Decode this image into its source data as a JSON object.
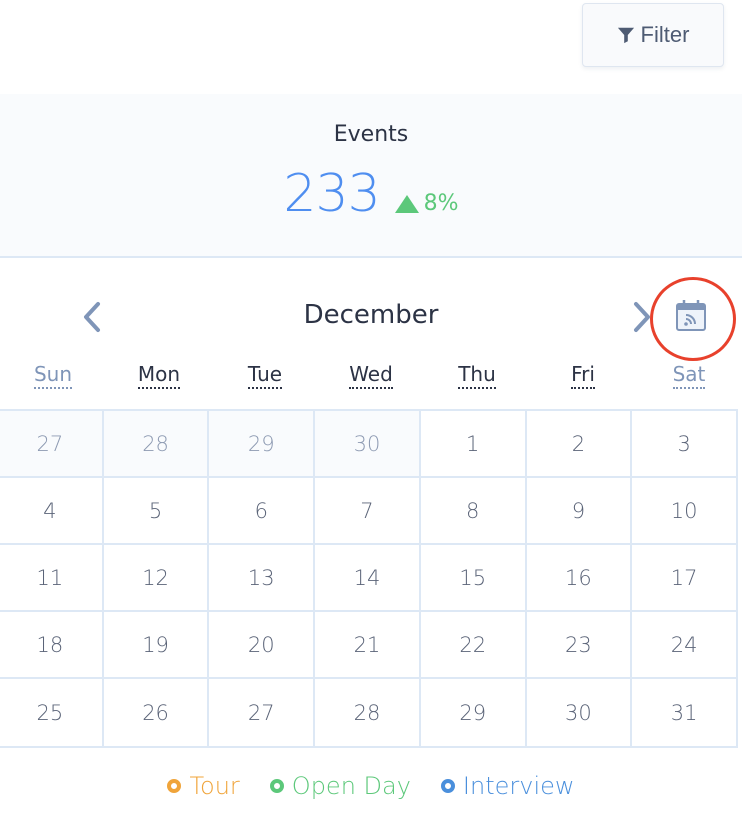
{
  "toolbar": {
    "filter_label": "Filter",
    "filter_icon": "funnel-icon"
  },
  "stats": {
    "title": "Events",
    "value": "233",
    "delta": "8%",
    "delta_direction": "up",
    "value_color": "#4f8ef0",
    "delta_color": "#5cc87a"
  },
  "calendar": {
    "month": "December",
    "prev_icon": "chevron-left-icon",
    "next_icon": "chevron-right-icon",
    "feed_icon": "calendar-feed-icon",
    "weekdays": [
      "Sun",
      "Mon",
      "Tue",
      "Wed",
      "Thu",
      "Fri",
      "Sat"
    ],
    "weeks": [
      [
        {
          "d": "27",
          "o": true
        },
        {
          "d": "28",
          "o": true
        },
        {
          "d": "29",
          "o": true
        },
        {
          "d": "30",
          "o": true
        },
        {
          "d": "1"
        },
        {
          "d": "2"
        },
        {
          "d": "3"
        }
      ],
      [
        {
          "d": "4"
        },
        {
          "d": "5"
        },
        {
          "d": "6"
        },
        {
          "d": "7"
        },
        {
          "d": "8"
        },
        {
          "d": "9"
        },
        {
          "d": "10"
        }
      ],
      [
        {
          "d": "11"
        },
        {
          "d": "12"
        },
        {
          "d": "13"
        },
        {
          "d": "14"
        },
        {
          "d": "15"
        },
        {
          "d": "16"
        },
        {
          "d": "17"
        }
      ],
      [
        {
          "d": "18"
        },
        {
          "d": "19"
        },
        {
          "d": "20"
        },
        {
          "d": "21"
        },
        {
          "d": "22"
        },
        {
          "d": "23"
        },
        {
          "d": "24"
        }
      ],
      [
        {
          "d": "25"
        },
        {
          "d": "26"
        },
        {
          "d": "27"
        },
        {
          "d": "28"
        },
        {
          "d": "29"
        },
        {
          "d": "30"
        },
        {
          "d": "31"
        }
      ]
    ]
  },
  "legend": [
    {
      "label": "Tour",
      "color": "#f0a43a"
    },
    {
      "label": "Open Day",
      "color": "#5cc87a"
    },
    {
      "label": "Interview",
      "color": "#4a8fdc"
    }
  ],
  "annotation": {
    "highlight_color": "#e8412c"
  }
}
